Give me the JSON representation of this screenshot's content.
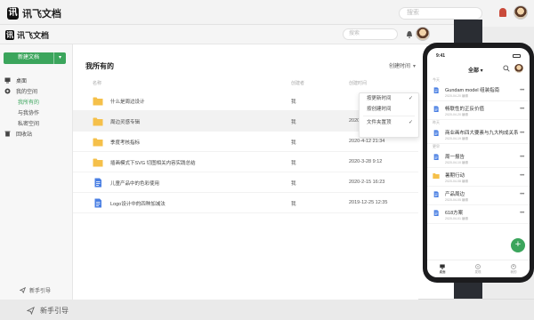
{
  "app": {
    "name": "讯飞文档",
    "logo_char": "讯"
  },
  "ghost": {
    "search_placeholder": "搜索",
    "guide_label": "新手引导"
  },
  "topbar": {
    "search_placeholder": "搜索"
  },
  "sidebar": {
    "new_button": "新建文档",
    "items": [
      {
        "label": "桌面",
        "icon": "monitor-icon"
      },
      {
        "label": "我的空间",
        "icon": "space-icon"
      },
      {
        "label": "我所有的",
        "sub": true,
        "active": true
      },
      {
        "label": "与我协作",
        "sub": true
      },
      {
        "label": "私密空间",
        "sub": true
      },
      {
        "label": "回收站",
        "icon": "trash-icon"
      }
    ],
    "guide_label": "新手引导"
  },
  "main": {
    "title": "我所有的",
    "sort_label": "创建时间",
    "columns": {
      "name": "名称",
      "owner": "创建者",
      "time": "创建时间"
    },
    "rows": [
      {
        "name": "什么是周边设计",
        "owner": "我",
        "time": "",
        "type": "folder",
        "selected": false
      },
      {
        "name": "周边灵感专辑",
        "owner": "我",
        "time": "2020-4-20 14:58",
        "type": "folder",
        "selected": true
      },
      {
        "name": "季度考核指标",
        "owner": "我",
        "time": "2020-4-12 21:34",
        "type": "folder",
        "selected": false
      },
      {
        "name": "插画模式下SVG 切图相关内容实践总结",
        "owner": "我",
        "time": "2020-3-28 9:12",
        "type": "folder",
        "selected": false
      },
      {
        "name": "儿童产品中的色彩使用",
        "owner": "我",
        "time": "2020-2-15 16:23",
        "type": "doc",
        "selected": false
      },
      {
        "name": "Logo设计中的四种加减法",
        "owner": "我",
        "time": "2019-12-25 12:35",
        "type": "doc",
        "selected": false
      }
    ],
    "sort_menu": [
      {
        "label": "按更新时间",
        "checked": true
      },
      {
        "label": "按创建时间",
        "checked": false
      },
      {
        "label": "文件夹置顶",
        "checked": true
      }
    ]
  },
  "phone": {
    "time": "9:41",
    "filter_label": "全部",
    "sections": [
      {
        "label": "今天",
        "items": [
          {
            "name": "Gundam model 组装指南",
            "meta": "2020-04-20 编辑",
            "type": "doc"
          },
          {
            "name": "畅联性的正反价值",
            "meta": "2020-04-20 编辑",
            "type": "doc"
          }
        ]
      },
      {
        "label": "昨天",
        "items": [
          {
            "name": "商业画布四大要素与九大构成关系",
            "meta": "2020-04-19 编辑",
            "type": "doc"
          }
        ]
      },
      {
        "label": "更早",
        "items": [
          {
            "name": "周一报告",
            "meta": "2020-04-10 编辑",
            "type": "doc"
          },
          {
            "name": "暑期行动",
            "meta": "2020-04-08 编辑",
            "type": "folder"
          },
          {
            "name": "产品周边",
            "meta": "2020-04-05 编辑",
            "type": "doc"
          },
          {
            "name": "618方案",
            "meta": "2020-04-01 编辑",
            "type": "doc"
          }
        ]
      }
    ],
    "tabs": [
      {
        "label": "桌面",
        "active": true
      },
      {
        "label": "发现",
        "active": false
      },
      {
        "label": "我的",
        "active": false
      }
    ]
  },
  "colors": {
    "accent": "#3ba55c",
    "folder": "#f5c04a",
    "doc": "#4a7fe3"
  }
}
